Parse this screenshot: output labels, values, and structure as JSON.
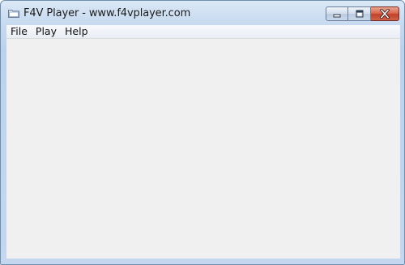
{
  "window": {
    "title": "F4V Player - www.f4vplayer.com",
    "icon": "folder-icon"
  },
  "caption_buttons": {
    "minimize": "minimize-icon",
    "maximize": "maximize-icon",
    "close": "close-icon"
  },
  "menu": {
    "items": [
      {
        "label": "File"
      },
      {
        "label": "Play"
      },
      {
        "label": "Help"
      }
    ]
  },
  "colors": {
    "frame": "#c6d9ef",
    "client": "#f0f0f0",
    "close_button": "#c8452e"
  }
}
